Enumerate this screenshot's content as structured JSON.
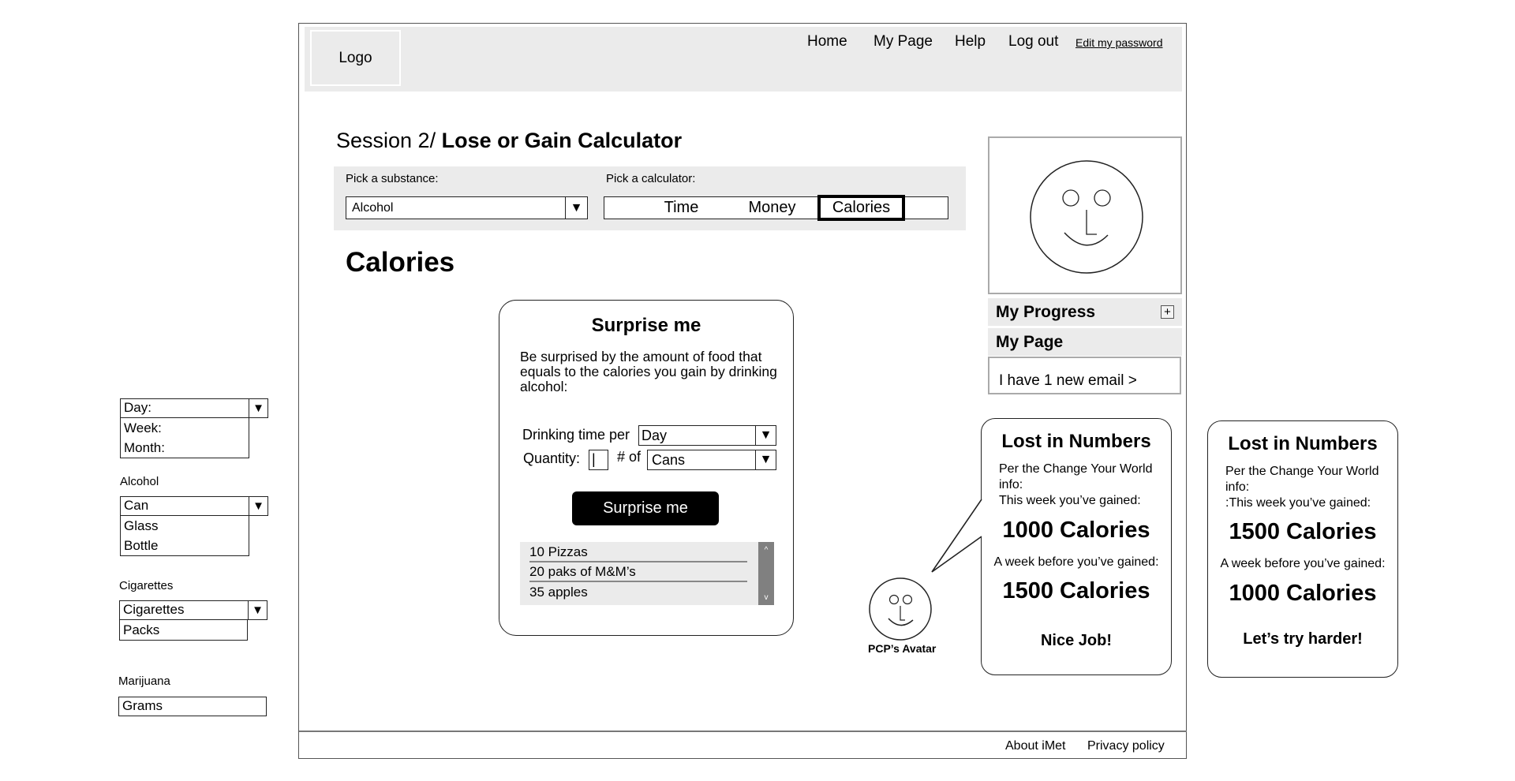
{
  "header": {
    "logo": "Logo",
    "nav": [
      "Home",
      "My Page",
      "Help",
      "Log out"
    ],
    "edit_password": "Edit my password"
  },
  "page": {
    "title_prefix": "Session 2/",
    "title_main": " Lose or Gain Calculator",
    "substance_label": "Pick a substance:",
    "substance_value": "Alcohol",
    "calculator_label": "Pick a calculator:",
    "calculator_tabs": [
      "Time",
      "Money",
      "Calories"
    ],
    "active_tab": "Calories",
    "section_heading": "Calories"
  },
  "surprise": {
    "title": "Surprise me",
    "description": "Be surprised by the amount of food that equals to the calories you gain by drinking alcohol:",
    "time_label": "Drinking time per",
    "time_value": "Day",
    "quantity_label": "Quantity:",
    "quantity_value": "|",
    "of_label": "# of",
    "unit_value": "Cans",
    "button": "Surprise me",
    "results": [
      "10 Pizzas",
      "20 paks of M&M’s",
      "35 apples"
    ],
    "scroll_up": "^",
    "scroll_down": "v"
  },
  "sidebar": {
    "progress": "My Progress",
    "progress_toggle": "+",
    "mypage": "My Page",
    "email": "I have 1 new email >"
  },
  "pcp": {
    "avatar_label": "PCP’s Avatar"
  },
  "bubbles": [
    {
      "title": "Lost in Numbers",
      "info": "Per the Change Your World info:",
      "this_week_label": "This week you’ve gained:",
      "this_week_value": "1000 Calories",
      "week_before_label": "A week before you’ve gained:",
      "week_before_value": "1500 Calories",
      "message": "Nice Job!"
    },
    {
      "title": "Lost in Numbers",
      "info": "Per the Change Your World info:",
      "this_week_label": ":This week you’ve gained:",
      "this_week_value": "1500 Calories",
      "week_before_label": "A week before you’ve gained:",
      "week_before_value": "1000 Calories",
      "message": "Let’s try harder!"
    }
  ],
  "annotations": {
    "time_dropdown": {
      "selected": "Day:",
      "options": [
        "Week:",
        "Month:"
      ]
    },
    "alcohol": {
      "label": "Alcohol",
      "selected": "Can",
      "options": [
        "Glass",
        "Bottle"
      ]
    },
    "cigarettes": {
      "label": "Cigarettes",
      "selected": "Cigarettes",
      "options": [
        "Packs"
      ]
    },
    "marijuana": {
      "label": "Marijuana",
      "value": "Grams"
    },
    "arrow": "▼"
  },
  "footer": {
    "links": [
      "About iMet",
      "Privacy policy"
    ]
  }
}
